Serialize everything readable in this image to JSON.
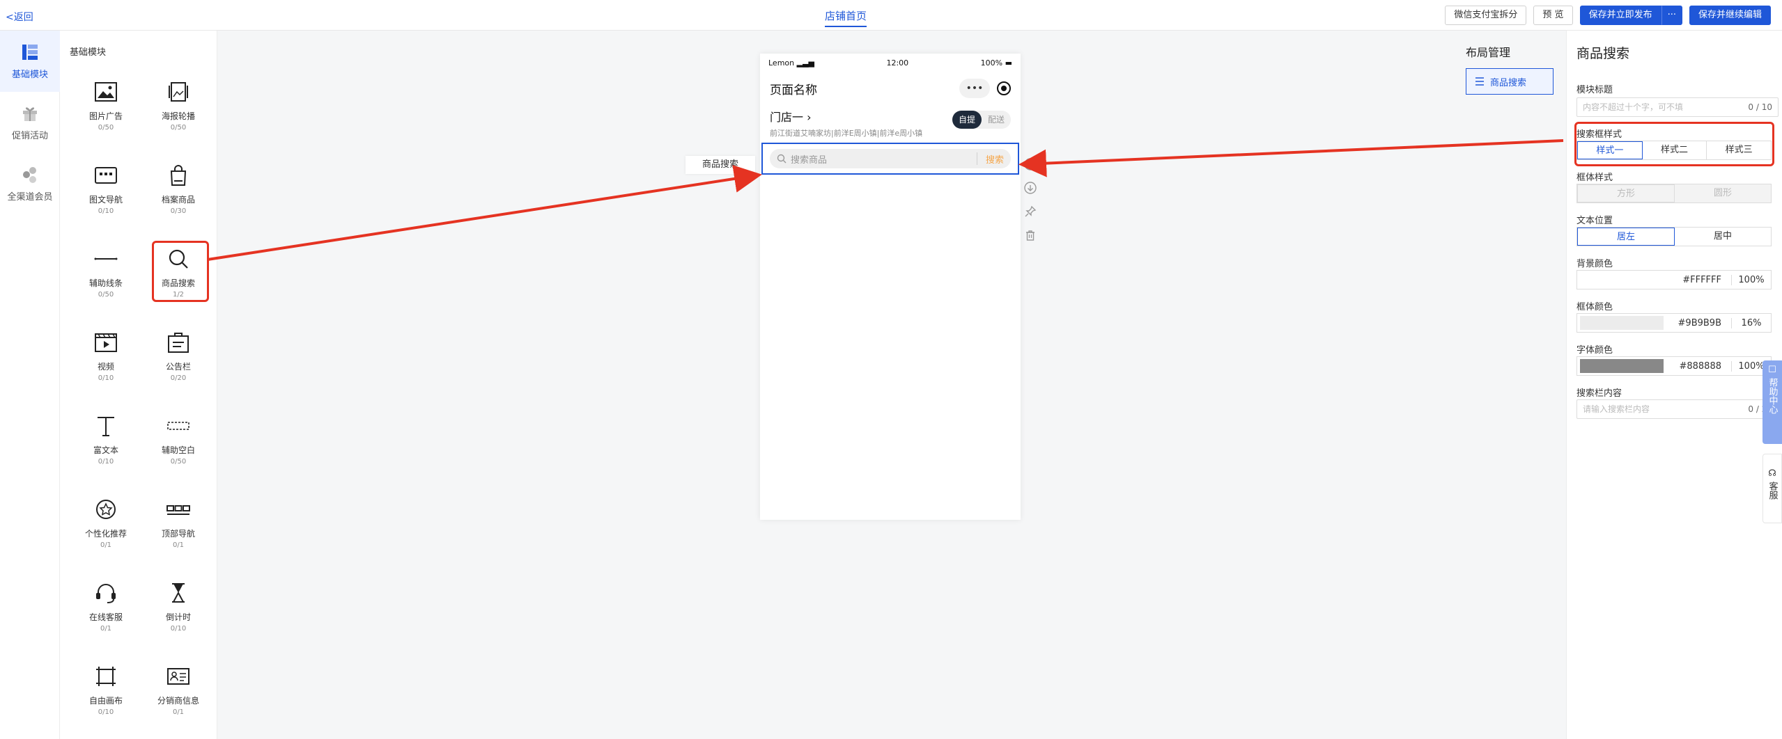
{
  "topbar": {
    "back": "<返回",
    "tab": "店铺首页",
    "btn_wechat": "微信支付宝拆分",
    "btn_preview": "预 览",
    "btn_publish": "保存并立即发布",
    "btn_more": "···",
    "btn_continue": "保存并继续编辑"
  },
  "leftnav": {
    "items": [
      {
        "label": "基础模块",
        "icon": "blocks-icon"
      },
      {
        "label": "促销活动",
        "icon": "gift-icon"
      },
      {
        "label": "全渠道会员",
        "icon": "members-icon"
      }
    ]
  },
  "palette": {
    "title": "基础模块",
    "items": [
      {
        "label": "图片广告",
        "count": "0/50",
        "icon": "image-icon"
      },
      {
        "label": "海报轮播",
        "count": "0/50",
        "icon": "carousel-icon"
      },
      {
        "label": "图文导航",
        "count": "0/10",
        "icon": "nav-icon"
      },
      {
        "label": "档案商品",
        "count": "0/30",
        "icon": "bag-icon"
      },
      {
        "label": "辅助线条",
        "count": "0/50",
        "icon": "line-icon"
      },
      {
        "label": "商品搜索",
        "count": "1/2",
        "icon": "search-icon"
      },
      {
        "label": "视频",
        "count": "0/10",
        "icon": "video-icon"
      },
      {
        "label": "公告栏",
        "count": "0/20",
        "icon": "notice-icon"
      },
      {
        "label": "富文本",
        "count": "0/10",
        "icon": "text-icon"
      },
      {
        "label": "辅助空白",
        "count": "0/50",
        "icon": "blank-icon"
      },
      {
        "label": "个性化推荐",
        "count": "0/1",
        "icon": "star-icon"
      },
      {
        "label": "顶部导航",
        "count": "0/1",
        "icon": "topnav-icon"
      },
      {
        "label": "在线客服",
        "count": "0/1",
        "icon": "headset-icon"
      },
      {
        "label": "倒计时",
        "count": "0/10",
        "icon": "hourglass-icon"
      },
      {
        "label": "自由画布",
        "count": "0/10",
        "icon": "canvas-icon"
      },
      {
        "label": "分销商信息",
        "count": "0/1",
        "icon": "idcard-icon"
      }
    ]
  },
  "phone": {
    "carrier": "Lemon",
    "time": "12:00",
    "battery": "100%",
    "page_title": "页面名称",
    "capsule_dots": "•••",
    "store_name": "门店一",
    "store_address": "前江街道艾喃家坊|前洋E周小镇|前洋e周小镇",
    "toggle_pickup": "自提",
    "toggle_delivery": "配送",
    "search_placeholder": "搜索商品",
    "search_button": "搜索"
  },
  "canvas": {
    "float_label": "商品搜索",
    "layout_title": "布局管理",
    "layout_item": "商品搜索"
  },
  "props": {
    "title": "商品搜索",
    "module_title_label": "模块标题",
    "module_title_placeholder": "内容不超过十个字，可不填",
    "module_title_count": "0 / 10",
    "search_style_label": "搜索框样式",
    "search_styles": [
      "样式一",
      "样式二",
      "样式三"
    ],
    "box_style_label": "框体样式",
    "box_styles": [
      "方形",
      "圆形"
    ],
    "text_pos_label": "文本位置",
    "text_positions": [
      "居左",
      "居中"
    ],
    "bg_color_label": "背景颜色",
    "bg_color": "#FFFFFF",
    "bg_pct": "100%",
    "box_color_label": "框体颜色",
    "box_color": "#9B9B9B",
    "box_pct": "16%",
    "font_color_label": "字体颜色",
    "font_color": "#888888",
    "font_pct": "100%",
    "search_content_label": "搜索栏内容",
    "search_content_placeholder": "请输入搜索栏内容",
    "search_content_count": "0 / 20"
  },
  "side_widgets": {
    "help": "帮助中心",
    "service": "客服"
  },
  "colors": {
    "accent": "#1f57d8",
    "highlight": "#e53322",
    "search_btn": "#f5a64a"
  }
}
